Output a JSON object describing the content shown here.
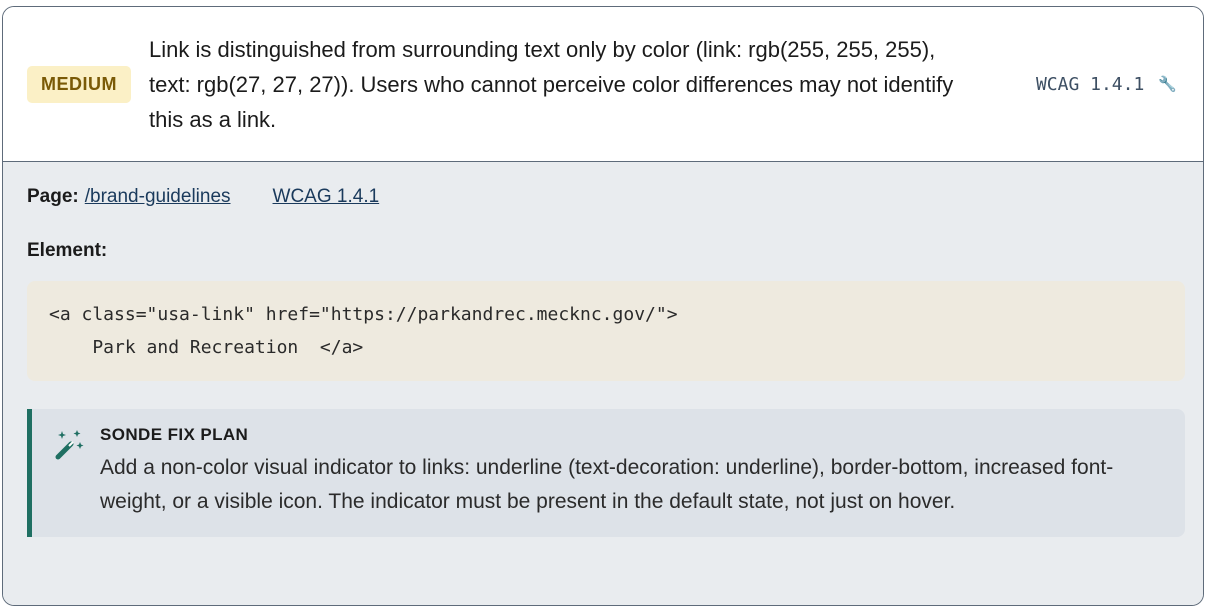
{
  "issue": {
    "severity": "MEDIUM",
    "description": "Link is distinguished from surrounding text only by color (link: rgb(255, 255, 255), text: rgb(27, 27, 27)). Users who cannot perceive color differences may not identify this as a link.",
    "wcag": "WCAG 1.4.1",
    "expand_icon": "wrench-icon"
  },
  "details": {
    "page_label": "Page:",
    "page_path": "/brand-guidelines",
    "wcag_link": "WCAG 1.4.1",
    "element_label": "Element:",
    "code": "<a class=\"usa-link\" href=\"https://parkandrec.mecknc.gov/\">\n    Park and Recreation  </a>"
  },
  "fix_plan": {
    "icon": "magic-wand-icon",
    "title": "SONDE FIX PLAN",
    "text": "Add a non-color visual indicator to links: underline (text-decoration: underline), border-bottom, increased font-weight, or a visible icon. The indicator must be present in the default state, not just on hover."
  },
  "colors": {
    "badge_bg": "#fbf0c6",
    "badge_text": "#7a5a07",
    "fix_accent": "#1f6f62",
    "details_bg": "#e9ecef",
    "code_bg": "#eeeadf"
  }
}
